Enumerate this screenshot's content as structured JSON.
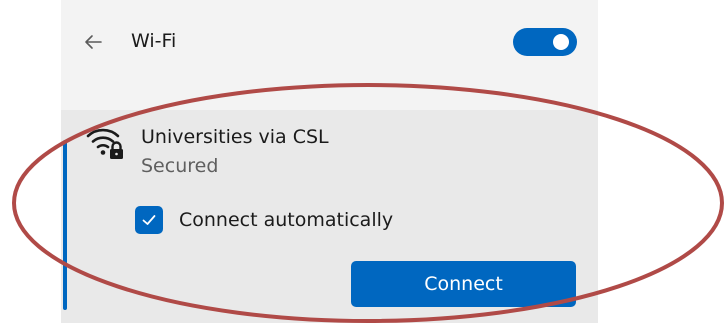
{
  "header": {
    "title": "Wi-Fi",
    "back_icon": "back-arrow-icon",
    "toggle_state": "on"
  },
  "network": {
    "name": "Universities via CSL",
    "status": "Secured",
    "icon": "wifi-secured-icon",
    "connect_automatically": {
      "label": "Connect automatically",
      "checked": true
    },
    "connect_label": "Connect"
  },
  "colors": {
    "accent": "#0067c0",
    "panel_background": "#f3f3f3",
    "card_background": "#e9e9e9",
    "annotation_ellipse": "#b04a47"
  }
}
